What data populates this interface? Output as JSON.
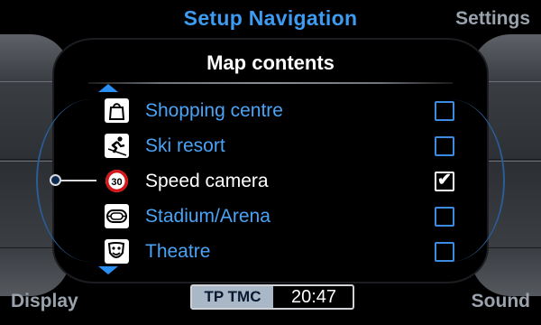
{
  "header": {
    "title": "Setup Navigation",
    "right_label": "Settings"
  },
  "footer": {
    "left_label": "Display",
    "right_label": "Sound"
  },
  "panel": {
    "title": "Map contents"
  },
  "list": {
    "items": [
      {
        "label": "Shopping centre",
        "icon": "shopping-bag-icon",
        "checked": false
      },
      {
        "label": "Ski resort",
        "icon": "skier-icon",
        "checked": false
      },
      {
        "label": "Speed camera",
        "icon": "speed-limit-30-icon",
        "checked": true,
        "selected": true,
        "icon_text": "30"
      },
      {
        "label": "Stadium/Arena",
        "icon": "stadium-icon",
        "checked": false
      },
      {
        "label": "Theatre",
        "icon": "theatre-masks-icon",
        "checked": false
      }
    ]
  },
  "status": {
    "tmc": "TP TMC",
    "time": "20:47"
  },
  "colors": {
    "accent": "#3d9bf2",
    "selected_text": "#ffffff",
    "side_label": "#9aa3ad"
  }
}
